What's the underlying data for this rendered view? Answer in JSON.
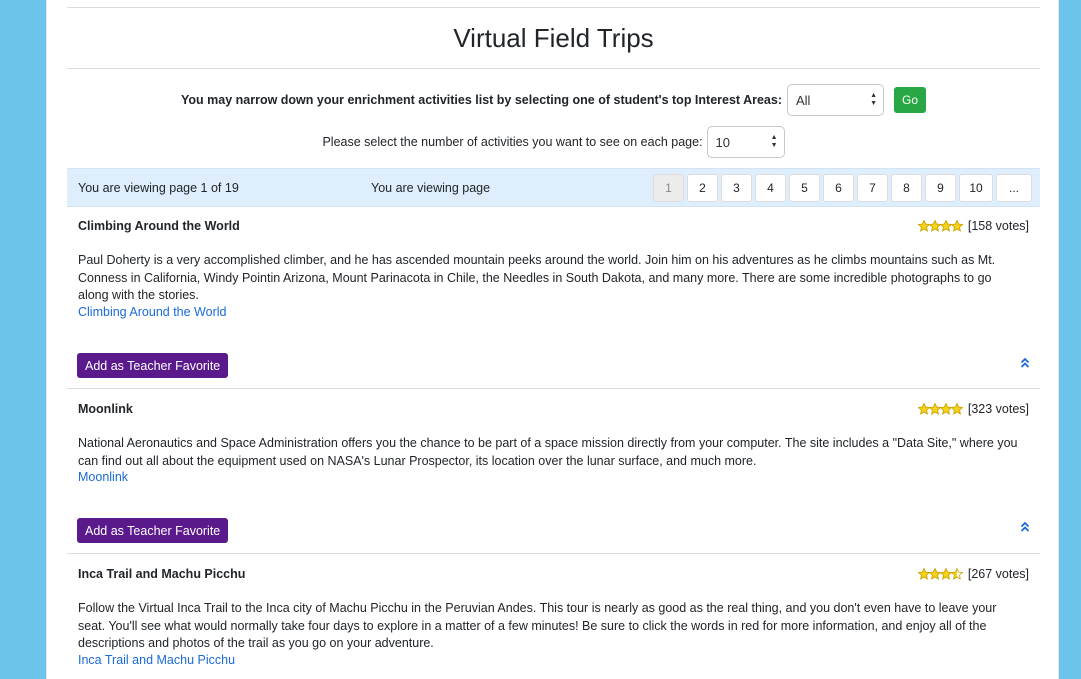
{
  "page_title": "Virtual Field Trips",
  "filter": {
    "label": "You may narrow down your enrichment activities list by selecting one of student's top Interest Areas:",
    "selected": "All",
    "go_label": "Go"
  },
  "per_page": {
    "label": "Please select the number of activities you want to see on each page:",
    "selected": "10"
  },
  "pager": {
    "status_left": "You are viewing page 1 of 19",
    "status_mid": "You are viewing page",
    "pages": [
      "1",
      "2",
      "3",
      "4",
      "5",
      "6",
      "7",
      "8",
      "9",
      "10",
      "..."
    ],
    "current_page": "1"
  },
  "colors": {
    "background": "#6cc4ec",
    "pager_bar": "#dfeefc",
    "go_button": "#28a745",
    "favorite_button": "#5b1a8c",
    "link": "#1a6ad8",
    "star": "#f7d21b"
  },
  "activities": [
    {
      "name": "Climbing Around the World",
      "stars": 4,
      "votes": "[158 votes]",
      "description": "Paul Doherty is a very accomplished climber, and he has ascended mountain peeks around the world. Join him on his adventures as he climbs mountains such as Mt. Conness in California, Windy Pointin Arizona, Mount Parinacota in Chile, the Needles in South Dakota, and many more. There are some incredible photographs to go along with the stories.",
      "link": "Climbing Around the World",
      "favorite_label": "Add as Teacher Favorite",
      "icon": "chevron-double-up-icon"
    },
    {
      "name": "Moonlink",
      "stars": 4,
      "votes": "[323 votes]",
      "description": "National Aeronautics and Space Administration offers you the chance to be part of a space mission directly from your computer. The site includes a \"Data Site,\" where you can find out all about the equipment used on NASA's Lunar Prospector, its location over the lunar surface, and much more.",
      "link": "Moonlink",
      "favorite_label": "Add as Teacher Favorite",
      "icon": "chevron-double-up-icon"
    },
    {
      "name": "Inca Trail and Machu Picchu",
      "stars": 3.5,
      "votes": "[267 votes]",
      "description": "Follow the Virtual Inca Trail to the Inca city of Machu Picchu in the Peruvian Andes. This tour is nearly as good as the real thing, and you don't even have to leave your seat. You'll see what would normally take four days to explore in a matter of a few minutes! Be sure to click the words in red for more information, and enjoy all of the descriptions and photos of the trail as you go on your adventure.",
      "link": "Inca Trail and Machu Picchu"
    }
  ]
}
